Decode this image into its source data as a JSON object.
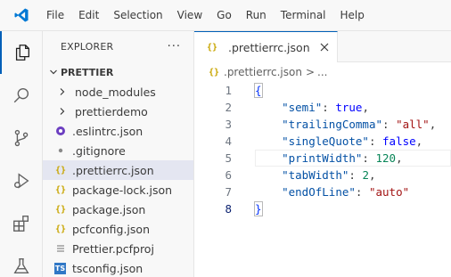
{
  "menu": [
    "File",
    "Edit",
    "Selection",
    "View",
    "Go",
    "Run",
    "Terminal",
    "Help"
  ],
  "sidebar": {
    "title": "EXPLORER",
    "more": "···",
    "folder": "PRETTIER",
    "items": [
      {
        "label": "node_modules",
        "type": "folder"
      },
      {
        "label": "prettierdemo",
        "type": "folder"
      },
      {
        "label": ".eslintrc.json",
        "type": "eslint"
      },
      {
        "label": ".gitignore",
        "type": "git"
      },
      {
        "label": ".prettierrc.json",
        "type": "json",
        "selected": true
      },
      {
        "label": "package-lock.json",
        "type": "json"
      },
      {
        "label": "package.json",
        "type": "json"
      },
      {
        "label": "pcfconfig.json",
        "type": "json"
      },
      {
        "label": "Prettier.pcfproj",
        "type": "proj"
      },
      {
        "label": "tsconfig.json",
        "type": "ts"
      }
    ]
  },
  "editor": {
    "tab": {
      "label": ".prettierrc.json",
      "icon": "{}"
    },
    "breadcrumb": {
      "file": ".prettierrc.json",
      "sep": ">",
      "rest": "..."
    },
    "lines": [
      {
        "num": "1",
        "text": "{"
      },
      {
        "num": "2",
        "key": "\"semi\"",
        "value": "true",
        "vtype": "b",
        "comma": ","
      },
      {
        "num": "3",
        "key": "\"trailingComma\"",
        "value": "\"all\"",
        "vtype": "s",
        "comma": ","
      },
      {
        "num": "4",
        "key": "\"singleQuote\"",
        "value": "false",
        "vtype": "b",
        "comma": ","
      },
      {
        "num": "5",
        "key": "\"printWidth\"",
        "value": "120",
        "vtype": "n",
        "comma": ","
      },
      {
        "num": "6",
        "key": "\"tabWidth\"",
        "value": "2",
        "vtype": "n",
        "comma": ","
      },
      {
        "num": "7",
        "key": "\"endOfLine\"",
        "value": "\"auto\"",
        "vtype": "s",
        "comma": ""
      },
      {
        "num": "8",
        "text": "}"
      }
    ]
  },
  "colors": {
    "accent": "#005fb8",
    "jsonIcon": "#c8a500",
    "tsIcon": "#3178c6"
  }
}
